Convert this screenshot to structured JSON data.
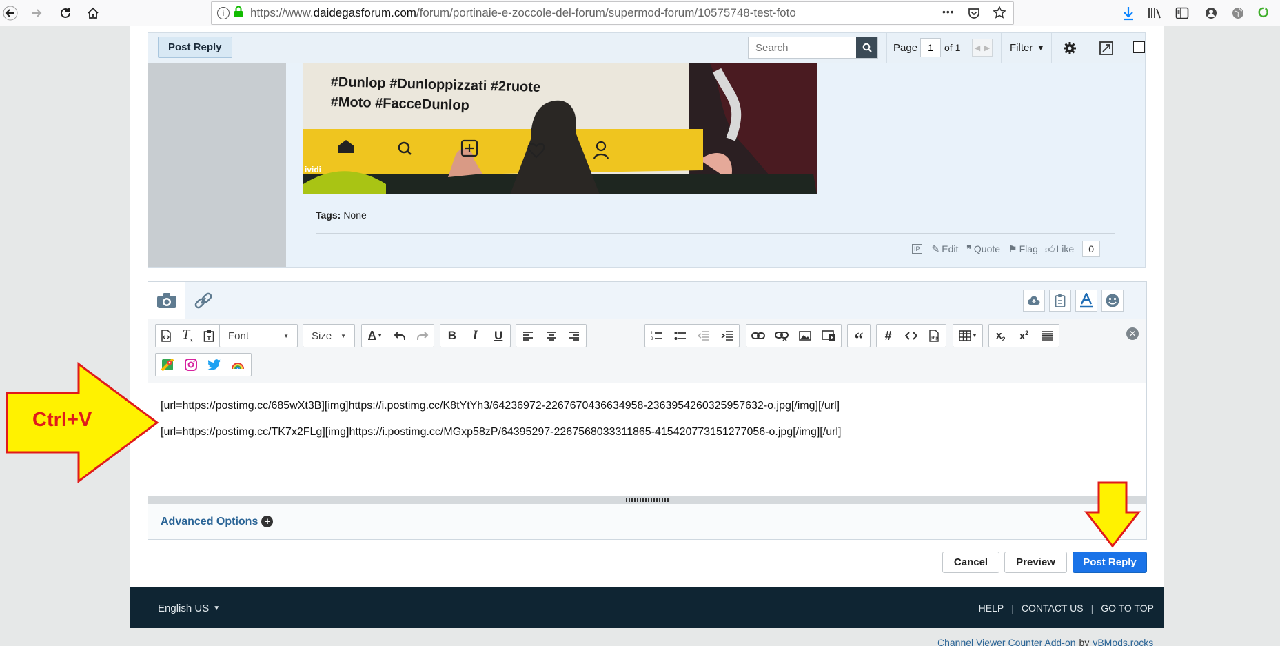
{
  "browser": {
    "url_prefix": "https://www.",
    "url_domain": "daidegasforum.com",
    "url_path": "/forum/portinaie-e-zoccole-del-forum/supermod-forum/10575748-test-foto",
    "more_glyph": "•••"
  },
  "thread_toolbar": {
    "post_reply_label": "Post Reply",
    "search_placeholder": "Search",
    "page_label": "Page",
    "page_value": "1",
    "page_of": "of 1",
    "filter_label": "Filter"
  },
  "post": {
    "photo_text_line1": "#Dunlop  #Dunloppizzati  #2ruote",
    "photo_text_line2": "#Moto  #FacceDunlop",
    "photo_corner_text": "ividi",
    "tags_label": "Tags:",
    "tags_value": "None",
    "actions": {
      "ip": "IP",
      "edit": "Edit",
      "quote": "Quote",
      "flag": "Flag",
      "like": "Like",
      "like_count": "0"
    }
  },
  "editor": {
    "font_select": "Font",
    "size_select": "Size",
    "lines": [
      "[url=https://postimg.cc/685wXt3B][img]https://i.postimg.cc/K8tYtYh3/64236972-2267670436634958-2363954260325957632-o.jpg[/img][/url]",
      "[url=https://postimg.cc/TK7x2FLg][img]https://i.postimg.cc/MGxp58zP/64395297-2267568033311865-415420773151277056-o.jpg[/img][/url]"
    ],
    "advanced_options_label": "Advanced Options"
  },
  "form_actions": {
    "cancel": "Cancel",
    "preview": "Preview",
    "post_reply": "Post Reply"
  },
  "annotation": {
    "arrow_label": "Ctrl+V",
    "arrow_fill": "#fff200",
    "arrow_stroke": "#e01b1b"
  },
  "footer": {
    "language": "English US",
    "help": "HELP",
    "contact": "CONTACT US",
    "go_top": "GO TO TOP",
    "addon_link": "Channel Viewer Counter Add-on",
    "addon_by": "by",
    "addon_author": "vBMods.rocks"
  },
  "colors": {
    "accent_blue": "#1a73e8",
    "footer_bg": "#0f2533",
    "link": "#2a6496"
  }
}
